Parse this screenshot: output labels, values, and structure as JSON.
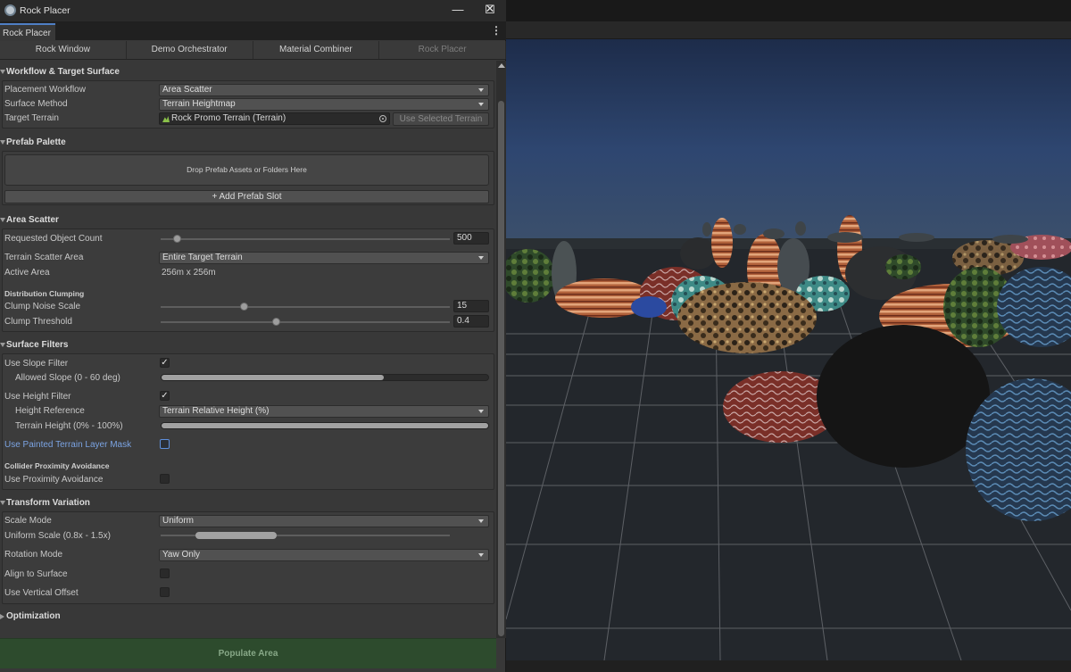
{
  "window": {
    "title": "Rock Placer",
    "tab_label": "Rock Placer",
    "minimize_glyph": "—",
    "maximize_glyph": "☐",
    "close_glyph": "✕",
    "menu_glyph": "⋮"
  },
  "subtabs": [
    "Rock Window",
    "Demo Orchestrator",
    "Material Combiner",
    "Rock Placer"
  ],
  "workflow": {
    "header": "Workflow & Target Surface",
    "placement_label": "Placement Workflow",
    "placement_value": "Area Scatter",
    "surface_label": "Surface Method",
    "surface_value": "Terrain Heightmap",
    "terrain_label": "Target Terrain",
    "terrain_value": "Rock Promo Terrain (Terrain)",
    "use_selected_label": "Use Selected Terrain"
  },
  "palette": {
    "header": "Prefab Palette",
    "drop_text": "Drop Prefab Assets or Folders Here",
    "add_slot_label": "+ Add Prefab Slot"
  },
  "scatter": {
    "header": "Area Scatter",
    "count_label": "Requested Object Count",
    "count_value": "500",
    "count_fraction": 0.06,
    "area_label": "Terrain Scatter Area",
    "area_value": "Entire Target Terrain",
    "active_label": "Active Area",
    "active_value": "256m x 256m",
    "clumping_label": "Distribution Clumping",
    "noise_label": "Clump Noise Scale",
    "noise_value": "15",
    "noise_fraction": 0.29,
    "threshold_label": "Clump Threshold",
    "threshold_value": "0.4",
    "threshold_fraction": 0.4
  },
  "filters": {
    "header": "Surface Filters",
    "slope_label": "Use Slope Filter",
    "slope_checked": "✓",
    "allowed_slope_label": "Allowed Slope (0 - 60 deg)",
    "slope_range": [
      0,
      0.68
    ],
    "height_label": "Use Height Filter",
    "height_checked": "✓",
    "height_ref_label": "Height Reference",
    "height_ref_value": "Terrain Relative Height (%)",
    "terrain_height_label": "Terrain Height (0% - 100%)",
    "height_range": [
      0,
      1
    ],
    "painted_label": "Use Painted Terrain Layer Mask",
    "collider_label": "Collider Proximity Avoidance",
    "proximity_label": "Use Proximity Avoidance"
  },
  "transform": {
    "header": "Transform Variation",
    "scale_mode_label": "Scale Mode",
    "scale_mode_value": "Uniform",
    "uniform_scale_label": "Uniform Scale (0.8x - 1.5x)",
    "scale_range": [
      0.8,
      1.5
    ],
    "rotation_label": "Rotation Mode",
    "rotation_value": "Yaw Only",
    "align_label": "Align to Surface",
    "offset_label": "Use Vertical Offset"
  },
  "optimization": {
    "header": "Optimization"
  },
  "populate_label": "Populate Area",
  "colors": {
    "accent": "#4f7fc5",
    "populate_bg": "#2d4b2d",
    "sky_top": "#1f2f4d",
    "ground": "#22262a"
  }
}
